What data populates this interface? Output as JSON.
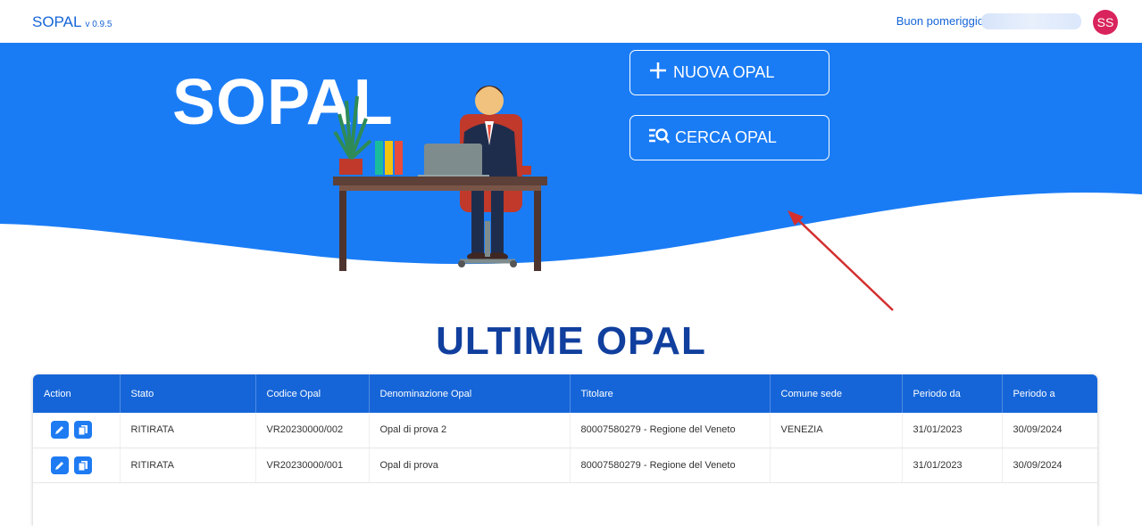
{
  "app": {
    "name": "SOPAL",
    "version": "v 0.9.5"
  },
  "user": {
    "greeting": "Buon pomeriggio",
    "initials": "SS"
  },
  "hero": {
    "title": "SOPAL",
    "new_button": "NUOVA OPAL",
    "search_button": "CERCA OPAL"
  },
  "section_title": "ULTIME OPAL",
  "table": {
    "headers": [
      "Action",
      "Stato",
      "Codice Opal",
      "Denominazione Opal",
      "Titolare",
      "Comune sede",
      "Periodo da",
      "Periodo a"
    ],
    "rows": [
      {
        "stato": "RITIRATA",
        "codice": "VR20230000/002",
        "denominazione": "Opal di prova 2",
        "titolare": "80007580279 - Regione del Veneto",
        "comune": "VENEZIA",
        "da": "31/01/2023",
        "a": "30/09/2024"
      },
      {
        "stato": "RITIRATA",
        "codice": "VR20230000/001",
        "denominazione": "Opal di prova",
        "titolare": "80007580279 - Regione del Veneto",
        "comune": "",
        "da": "31/01/2023",
        "a": "30/09/2024"
      }
    ]
  },
  "colors": {
    "primary": "#1565d8",
    "hero_bg": "#1a7cf5",
    "title": "#103f9e",
    "avatar": "#d9235c"
  },
  "icons": [
    "plus-icon",
    "search-list-icon",
    "edit-icon",
    "copy-icon"
  ]
}
